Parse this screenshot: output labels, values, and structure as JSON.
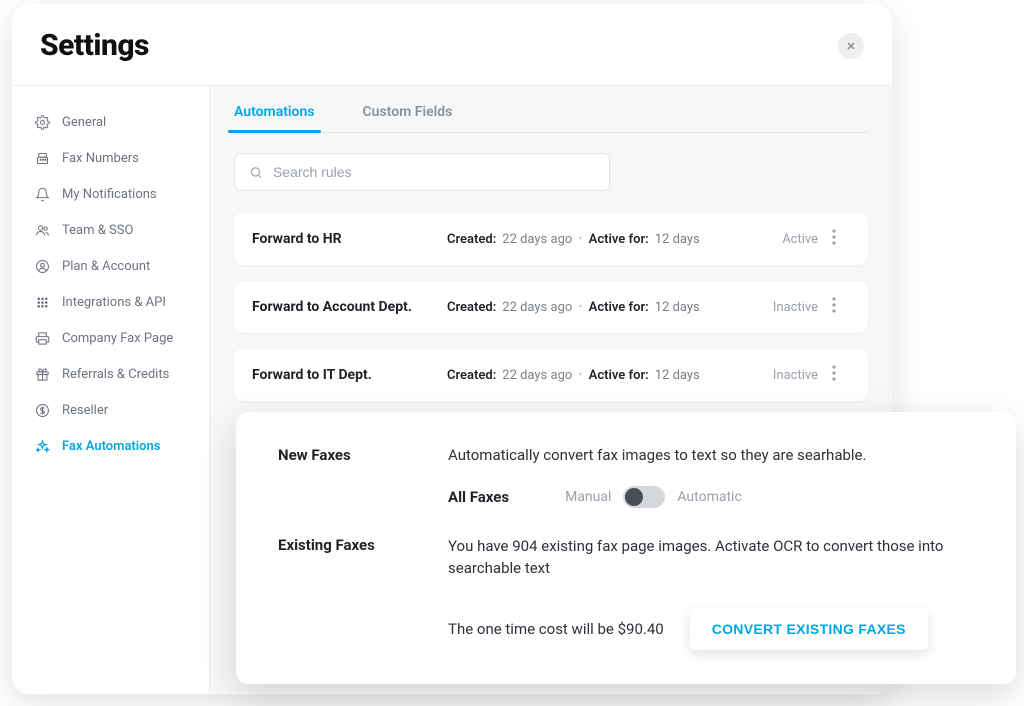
{
  "header": {
    "title": "Settings"
  },
  "sidebar": {
    "items": [
      {
        "label": "General",
        "icon": "gear"
      },
      {
        "label": "Fax Numbers",
        "icon": "fax"
      },
      {
        "label": "My Notifications",
        "icon": "bell"
      },
      {
        "label": "Team & SSO",
        "icon": "users"
      },
      {
        "label": "Plan & Account",
        "icon": "user-circle"
      },
      {
        "label": "Integrations & API",
        "icon": "grid"
      },
      {
        "label": "Company Fax Page",
        "icon": "printer"
      },
      {
        "label": "Referrals & Credits",
        "icon": "gift"
      },
      {
        "label": "Reseller",
        "icon": "dollar"
      },
      {
        "label": "Fax  Automations",
        "icon": "sparkles",
        "active": true
      }
    ]
  },
  "tabs": [
    {
      "label": "Automations",
      "active": true
    },
    {
      "label": "Custom Fields"
    }
  ],
  "search": {
    "placeholder": "Search rules"
  },
  "rules": [
    {
      "name": "Forward to HR",
      "created_label": "Created:",
      "created_value": "22 days ago",
      "active_label": "Active for:",
      "active_value": "12 days",
      "status": "Active"
    },
    {
      "name": "Forward to Account Dept.",
      "created_label": "Created:",
      "created_value": "22 days ago",
      "active_label": "Active for:",
      "active_value": "12 days",
      "status": "Inactive"
    },
    {
      "name": "Forward to IT Dept.",
      "created_label": "Created:",
      "created_value": "22 days ago",
      "active_label": "Active for:",
      "active_value": "12 days",
      "status": "Inactive"
    }
  ],
  "panel": {
    "new_label": "New Faxes",
    "new_desc": "Automatically convert fax images to text so they are searhable.",
    "all_faxes_label": "All Faxes",
    "toggle_left": "Manual",
    "toggle_right": "Automatic",
    "existing_label": "Existing Faxes",
    "existing_desc": "You have 904 existing fax page images. Activate OCR  to convert those into searchable text",
    "cost_text": "The one time cost will be $90.40",
    "convert_button": "CONVERT EXISTING FAXES"
  }
}
